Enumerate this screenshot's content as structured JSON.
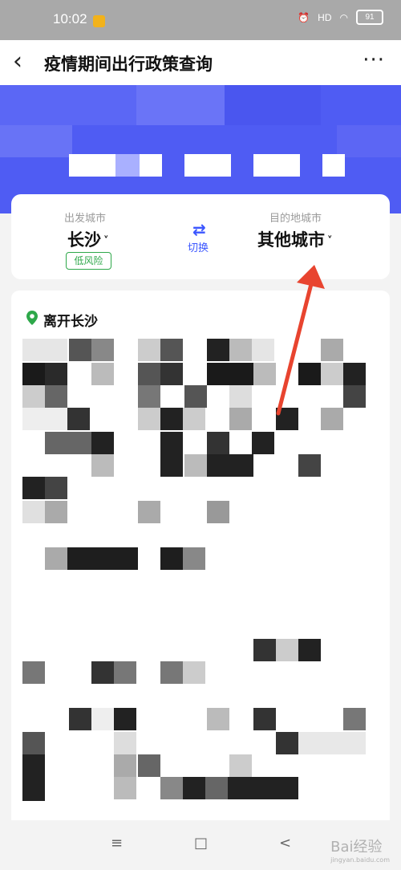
{
  "status": {
    "time": "10:02",
    "battery": "91",
    "net": "HD"
  },
  "header": {
    "back_icon": "‹",
    "title": "疫情期间出行政策查询",
    "more_icon": "···"
  },
  "route": {
    "origin_label": "出发城市",
    "origin_city": "长沙",
    "origin_caret": "˅",
    "risk_badge": "低风险",
    "swap_label": "切换",
    "swap_icon": "⇄",
    "destination_label": "目的地城市",
    "destination_city": "其他城市",
    "destination_caret": "˅"
  },
  "section": {
    "title": "离开长沙"
  },
  "nav": {
    "menu_icon": "≡",
    "home_icon": "□",
    "back_icon": "<"
  },
  "watermark": {
    "text": "Bai经验",
    "sub": "jingyan.baidu.com"
  },
  "colors": {
    "accent": "#3b56ff",
    "hero": "#4f5cf3",
    "risk": "#2ea84a",
    "arrow": "#e8442f"
  }
}
